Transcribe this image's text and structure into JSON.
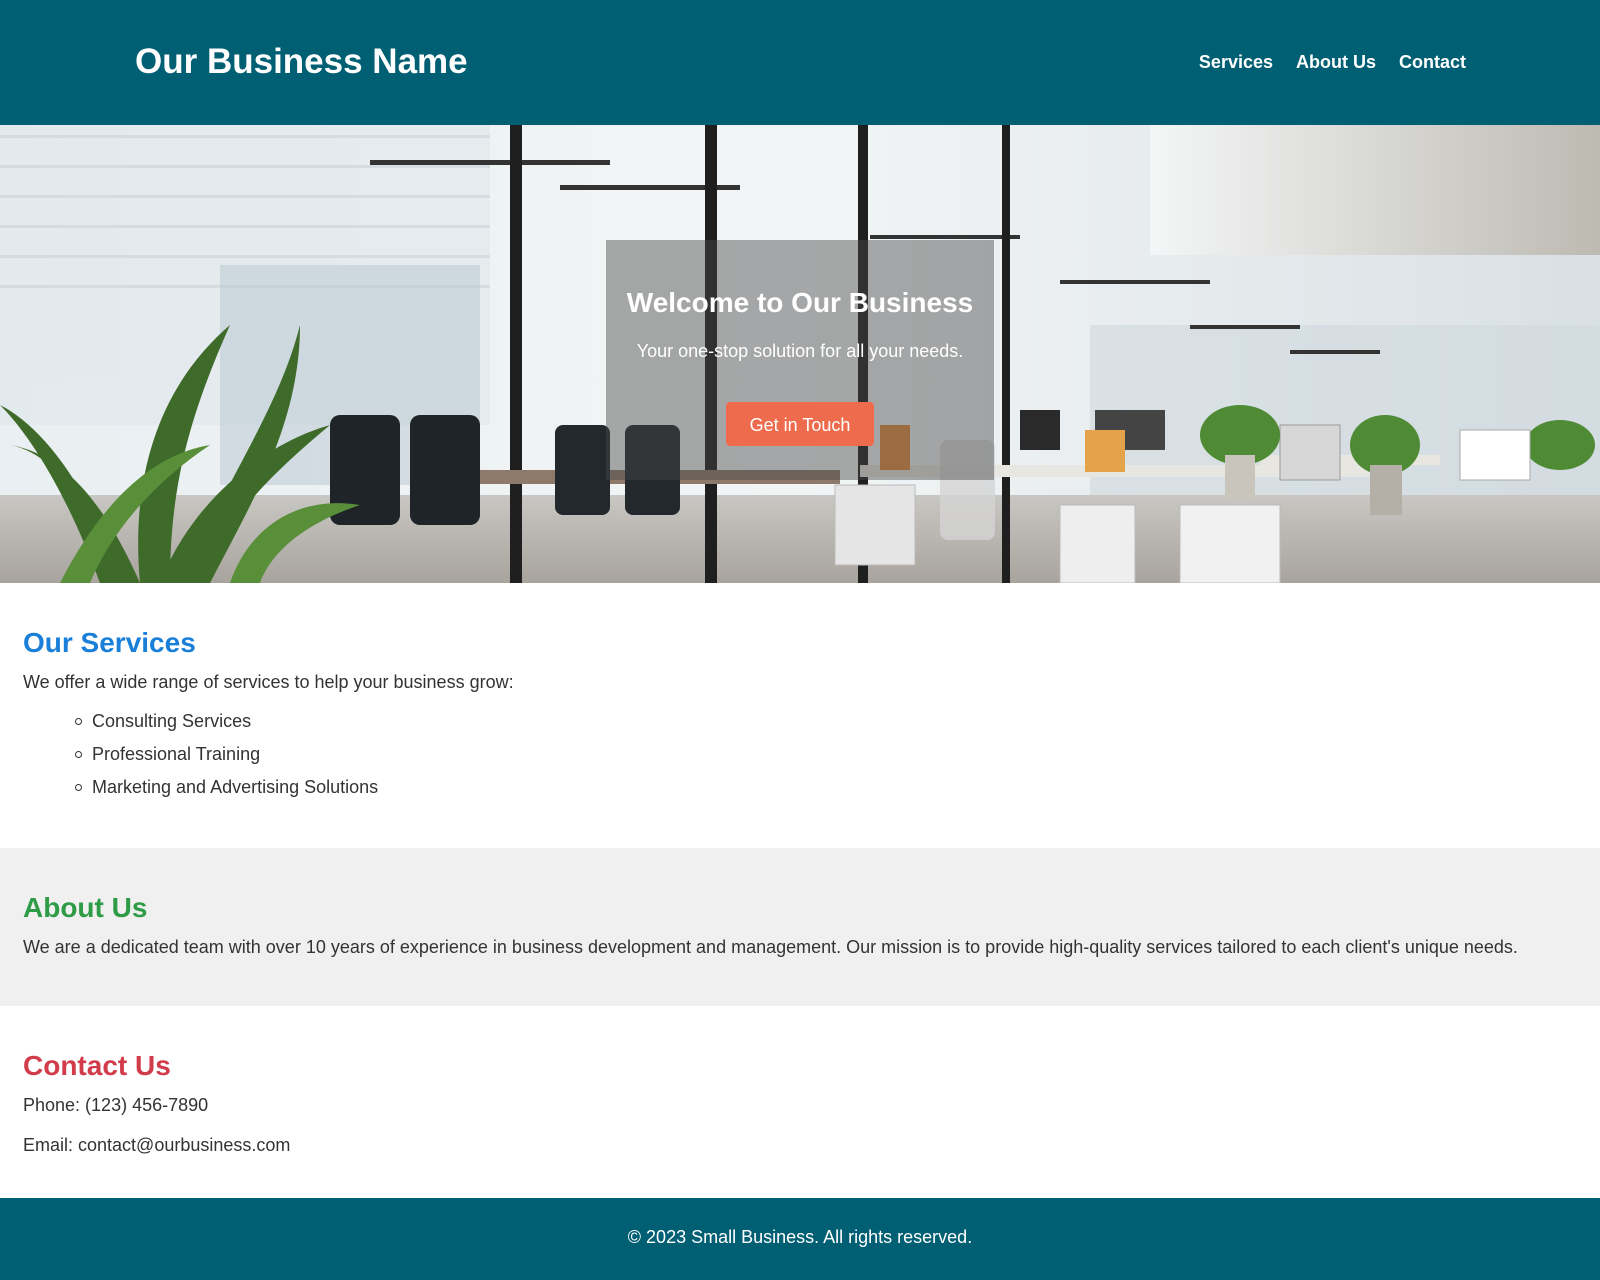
{
  "header": {
    "site_title": "Our Business Name",
    "nav": [
      {
        "label": "Services"
      },
      {
        "label": "About Us"
      },
      {
        "label": "Contact"
      }
    ]
  },
  "hero": {
    "title": "Welcome to Our Business",
    "subtitle": "Your one-stop solution for all your needs.",
    "cta_label": "Get in Touch"
  },
  "services": {
    "heading": "Our Services",
    "intro": "We offer a wide range of services to help your business grow:",
    "items": [
      "Consulting Services",
      "Professional Training",
      "Marketing and Advertising Solutions"
    ]
  },
  "about": {
    "heading": "About Us",
    "text": "We are a dedicated team with over 10 years of experience in business development and management. Our mission is to provide high-quality services tailored to each client's unique needs."
  },
  "contact": {
    "heading": "Contact Us",
    "phone": "Phone: (123) 456-7890",
    "email": "Email: contact@ourbusiness.com"
  },
  "footer": {
    "text": "© 2023 Small Business. All rights reserved."
  },
  "colors": {
    "header_bg": "#005f73",
    "cta_bg": "#ee6c4d",
    "services_heading": "#1a7fd8",
    "about_heading": "#2e9c46",
    "contact_heading": "#d13b4a"
  }
}
